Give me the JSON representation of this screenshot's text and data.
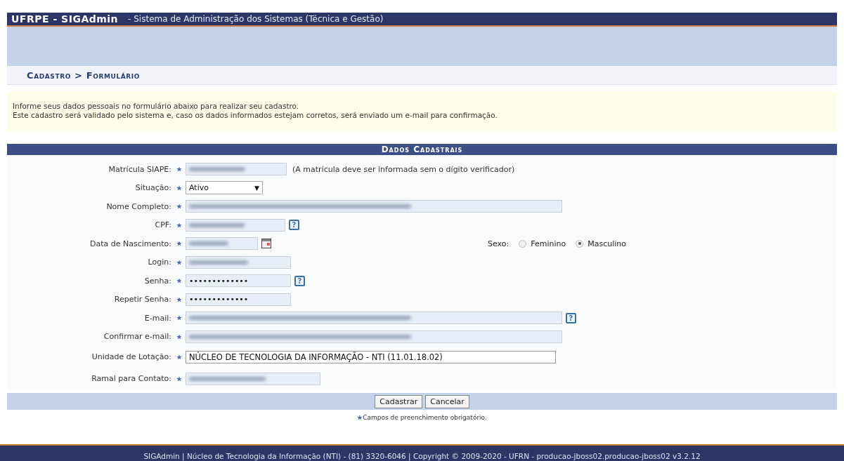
{
  "header": {
    "system": "UFRPE - SIGAdmin",
    "subtitle": "- Sistema de Administração dos Sistemas (Técnica e Gestão)"
  },
  "breadcrumb": "Cadastro > Formulário",
  "info": [
    "Informe seus dados pessoais no formulário abaixo para realizar seu cadastro.",
    "Este cadastro será validado pelo sistema e, caso os dados informados estejam corretos, será enviado um e-mail para confirmação."
  ],
  "form": {
    "title": "Dados Cadastrais",
    "fields": [
      {
        "kind": "text",
        "label": "Matrícula SIAPE:",
        "redacted": true,
        "note": "(A matrícula deve ser informada sem o dígito verificador)"
      },
      {
        "kind": "select",
        "label": "Situação:",
        "value": "Ativo",
        "caret": "▼"
      },
      {
        "kind": "text",
        "label": "Nome Completo:",
        "redacted": true
      },
      {
        "kind": "text",
        "label": "CPF:",
        "redacted": true,
        "help": "?"
      },
      {
        "kind": "date",
        "label": "Data de Nascimento:",
        "redacted": true,
        "side": {
          "label": "Sexo:",
          "options": [
            {
              "label": "Feminino",
              "selected": false
            },
            {
              "label": "Masculino",
              "selected": true
            }
          ]
        }
      },
      {
        "kind": "text",
        "label": "Login:",
        "redacted": true
      },
      {
        "kind": "password",
        "label": "Senha:",
        "value": "•••••••••••••",
        "help": "?"
      },
      {
        "kind": "password",
        "label": "Repetir Senha:",
        "value": "•••••••••••••"
      },
      {
        "kind": "text",
        "label": "E-mail:",
        "redacted": true,
        "help": "?"
      },
      {
        "kind": "text",
        "label": "Confirmar e-mail:",
        "redacted": true
      },
      {
        "kind": "plain",
        "label": "Unidade de Lotação:",
        "value": "NÚCLEO DE TECNOLOGIA DA INFORMAÇÃO - NTI (11.01.18.02)"
      },
      {
        "kind": "text",
        "label": "Ramal para Contato:",
        "redacted": true
      }
    ],
    "buttons": [
      "Cadastrar",
      "Cancelar"
    ],
    "required_note": "Campos de preenchimento obrigatório."
  },
  "footer": "SIGAdmin | Núcleo de Tecnologia da Informação (NTI) - (81) 3320-6046 | Copyright © 2009-2020 - UFRN - producao-jboss02.producao-jboss02 v3.2.12"
}
